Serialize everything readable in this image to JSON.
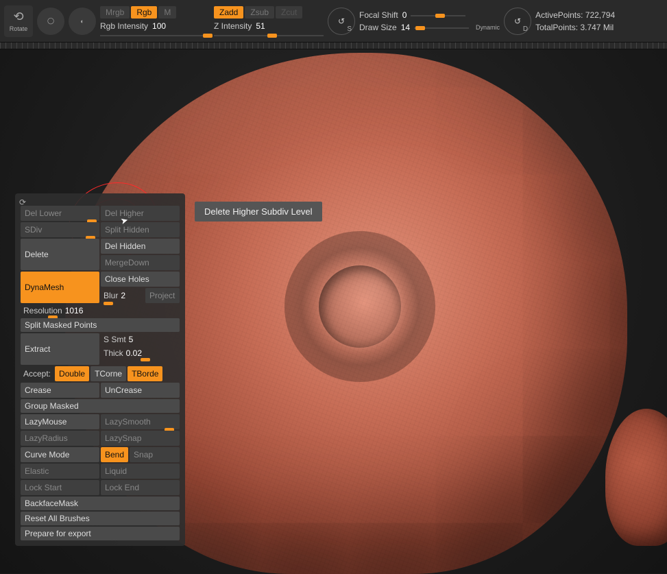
{
  "toolbar": {
    "rotate_label": "Rotate",
    "mrgb": "Mrgb",
    "rgb": "Rgb",
    "m": "M",
    "rgb_intensity_label": "Rgb Intensity",
    "rgb_intensity_val": "100",
    "zadd": "Zadd",
    "zsub": "Zsub",
    "zcut": "Zcut",
    "z_intensity_label": "Z Intensity",
    "z_intensity_val": "51",
    "focal_shift_label": "Focal Shift",
    "focal_shift_val": "0",
    "draw_size_label": "Draw Size",
    "draw_size_val": "14",
    "dynamic": "Dynamic",
    "active_points_label": "ActivePoints:",
    "active_points_val": "722,794",
    "total_points_label": "TotalPoints:",
    "total_points_val": "3.747 Mil"
  },
  "tooltip": {
    "text": "Delete Higher Subdiv Level"
  },
  "panel": {
    "del_lower": "Del Lower",
    "del_higher": "Del Higher",
    "sdiv": "SDiv",
    "split_hidden": "Split Hidden",
    "delete": "Delete",
    "del_hidden": "Del Hidden",
    "merge_down": "MergeDown",
    "dynamesh": "DynaMesh",
    "close_holes": "Close Holes",
    "blur_label": "Blur",
    "blur_val": "2",
    "project": "Project",
    "resolution_label": "Resolution",
    "resolution_val": "1016",
    "split_masked": "Split Masked Points",
    "extract": "Extract",
    "ssmt_label": "S Smt",
    "ssmt_val": "5",
    "thick_label": "Thick",
    "thick_val": "0.02",
    "accept": "Accept:",
    "double": "Double",
    "tcorne": "TCorne",
    "tborde": "TBorde",
    "crease": "Crease",
    "uncrease": "UnCrease",
    "group_masked": "Group Masked",
    "lazymouse": "LazyMouse",
    "lazysmooth": "LazySmooth",
    "lazyradius": "LazyRadius",
    "lazysnap": "LazySnap",
    "curve_mode": "Curve Mode",
    "bend": "Bend",
    "snap": "Snap",
    "elastic": "Elastic",
    "liquid": "Liquid",
    "lock_start": "Lock Start",
    "lock_end": "Lock End",
    "backface_mask": "BackfaceMask",
    "reset_brushes": "Reset All Brushes",
    "prepare_export": "Prepare for export"
  }
}
